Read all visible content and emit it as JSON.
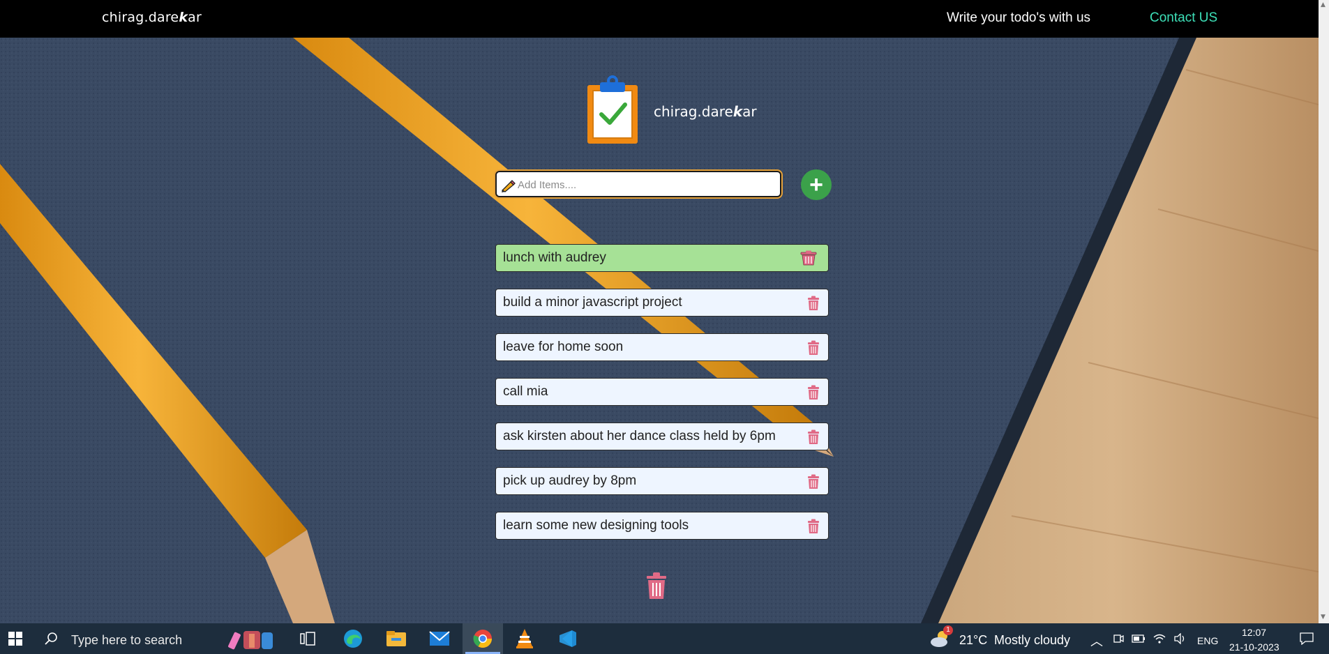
{
  "nav": {
    "brand_prefix": "chirag.dare",
    "brand_k": "k",
    "brand_suffix": "ar",
    "write_link": "Write your todo's with us",
    "contact_link": "Contact US"
  },
  "logo": {
    "caption_prefix": "chirag.dare",
    "caption_k": "k",
    "caption_suffix": "ar"
  },
  "add": {
    "placeholder": "Add Items....",
    "value": "",
    "button_label": "+"
  },
  "todos": [
    {
      "text": "lunch with audrey",
      "done": true
    },
    {
      "text": "build a minor javascript project",
      "done": false
    },
    {
      "text": "leave for home soon",
      "done": false
    },
    {
      "text": "call mia",
      "done": false
    },
    {
      "text": "ask kirsten about her dance class held by 6pm",
      "done": false
    },
    {
      "text": "pick up audrey by 8pm",
      "done": false
    },
    {
      "text": "learn some new designing tools",
      "done": false
    }
  ],
  "taskbar": {
    "search_placeholder": "Type here to search",
    "weather_temp": "21°C",
    "weather_desc": "Mostly cloudy",
    "weather_badge": "1",
    "language": "ENG",
    "time": "12:07",
    "date": "21-10-2023"
  },
  "colors": {
    "nav_bg": "#000000",
    "contact_link": "#3de0b8",
    "done_item_bg": "#a6e196",
    "item_bg": "#eef5ff",
    "add_button": "#3ba14a",
    "trash": "#e06a86",
    "taskbar_bg": "#1d2d3d"
  },
  "icons": {
    "logo": "clipboard-check-icon",
    "input_prefix": "pencil-icon",
    "add": "plus-icon",
    "delete": "trash-icon",
    "clear_all": "trash-icon"
  }
}
